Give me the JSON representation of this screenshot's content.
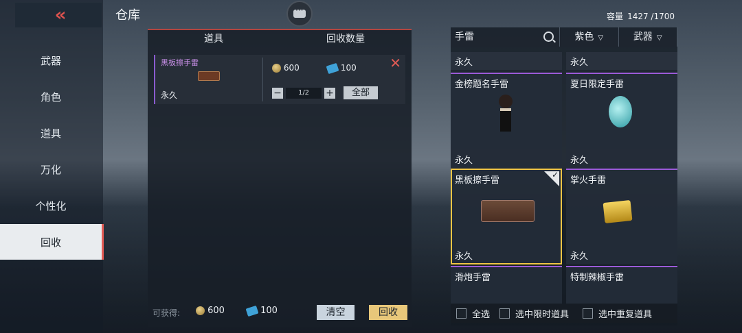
{
  "header": {
    "title": "仓库",
    "capacity_label": "容量",
    "capacity_value": "1427 /1700"
  },
  "sidebar": {
    "items": [
      {
        "label": "武器"
      },
      {
        "label": "角色"
      },
      {
        "label": "道具"
      },
      {
        "label": "万化"
      },
      {
        "label": "个性化"
      },
      {
        "label": "回收"
      }
    ],
    "active": "回收"
  },
  "recycle": {
    "col_item": "道具",
    "col_qty": "回收数量",
    "rows": [
      {
        "name": "黑板擦手雷",
        "term": "永久",
        "coins": "600",
        "tickets": "100",
        "qty": "1/2",
        "all_label": "全部"
      }
    ],
    "footer": {
      "earn_label": "可获得:",
      "coins": "600",
      "tickets": "100",
      "clear_label": "清空",
      "recycle_label": "回收"
    }
  },
  "filter": {
    "search_value": "手雷",
    "quality": "紫色",
    "type": "武器"
  },
  "grid": {
    "top_strips": [
      "永久",
      "永久"
    ],
    "cards": [
      {
        "name": "金榜题名手雷",
        "term": "永久"
      },
      {
        "name": "夏日限定手雷",
        "term": "永久"
      },
      {
        "name": "黑板擦手雷",
        "term": "永久",
        "selected": true
      },
      {
        "name": "掌火手雷",
        "term": "永久"
      },
      {
        "name": "滑炮手雷",
        "term": ""
      },
      {
        "name": "特制辣椒手雷",
        "term": ""
      }
    ]
  },
  "bottom": {
    "select_all": "全选",
    "select_limited": "选中限时道具",
    "select_dup": "选中重复道具"
  },
  "colors": {
    "accent": "#e35b55",
    "purple": "#9b5ad8",
    "gold": "#f0c544"
  }
}
